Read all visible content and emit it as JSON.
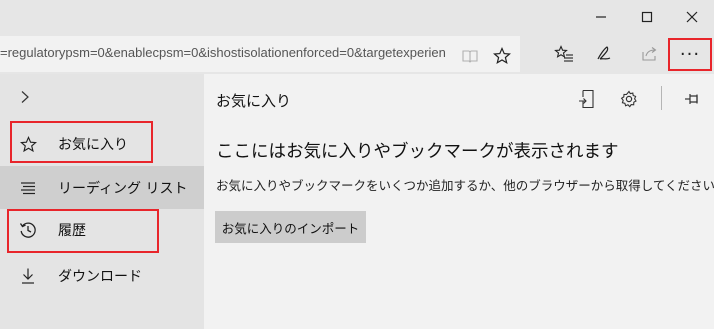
{
  "window": {
    "minimize_glyph": "—",
    "maximize_glyph": "☐",
    "close_glyph": "✕"
  },
  "toolbar": {
    "url": "=regulatorypsm=0&enablecpsm=0&ishostisolationenforced=0&targetexperien",
    "more_label": "···"
  },
  "icons": {
    "reading_view": "reading-view-icon",
    "add_favorite": "star-icon",
    "hub": "hub-icon",
    "notes": "pen-icon",
    "share": "share-icon",
    "collapse": "chevron-right-icon",
    "import": "import-icon",
    "settings": "gear-icon",
    "pin": "pin-icon"
  },
  "hub": {
    "nav": [
      {
        "label": "お気に入り",
        "icon": "star-icon"
      },
      {
        "label": "リーディング リスト",
        "icon": "reading-list-icon"
      },
      {
        "label": "履歴",
        "icon": "history-icon"
      },
      {
        "label": "ダウンロード",
        "icon": "download-icon"
      }
    ],
    "pane": {
      "title": "お気に入り",
      "empty_heading": "ここにはお気に入りやブックマークが表示されます",
      "empty_desc": "お気に入りやブックマークをいくつか追加するか、他のブラウザーから取得してください。",
      "import_button": "お気に入りのインポート"
    }
  },
  "colors": {
    "highlight": "#e8252b",
    "nav_bg": "#e4e4e4",
    "nav_selected_bg": "#cfcfcf",
    "pane_bg": "#f2f2f2",
    "button_bg": "#cccccc"
  }
}
